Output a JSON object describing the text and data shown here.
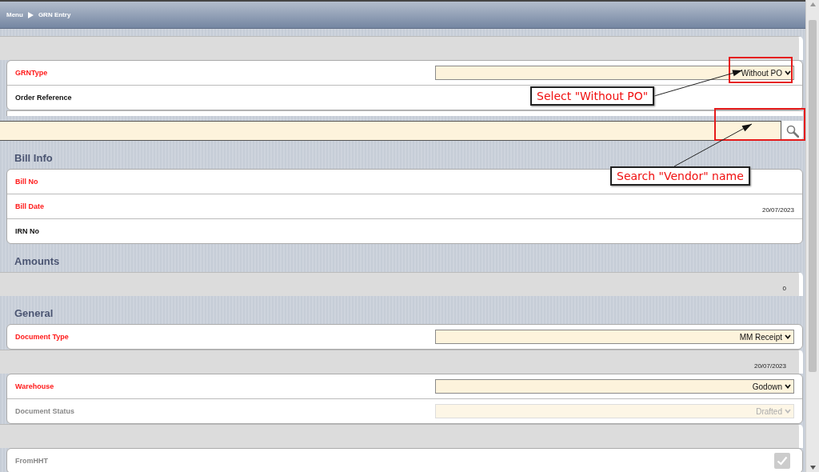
{
  "breadcrumb": [
    "Menu",
    "GRN Entry"
  ],
  "form": [
    {
      "kind": "strip"
    },
    {
      "kind": "card",
      "fields": [
        {
          "label": "GRNType",
          "kind": "select",
          "required": true,
          "disabled": false,
          "value": "Without PO"
        },
        {
          "label": "Order Reference",
          "kind": "plain",
          "required": false,
          "disabled": false
        }
      ]
    },
    {
      "kind": "search"
    },
    {
      "kind": "heading",
      "text": "Bill Info"
    },
    {
      "kind": "card",
      "fields": [
        {
          "label": "Bill No",
          "kind": "plain",
          "required": true,
          "disabled": false
        },
        {
          "label": "Bill Date",
          "kind": "plain",
          "required": true,
          "disabled": false,
          "value": "20/07/2023"
        },
        {
          "label": "IRN No",
          "kind": "plain",
          "required": false,
          "disabled": false
        }
      ]
    },
    {
      "kind": "heading",
      "text": "Amounts"
    },
    {
      "kind": "strip",
      "value": "0"
    },
    {
      "kind": "heading",
      "text": "General"
    },
    {
      "kind": "card",
      "fields": [
        {
          "label": "Document Type",
          "kind": "select",
          "required": true,
          "disabled": false,
          "value": "MM Receipt"
        }
      ]
    },
    {
      "kind": "strip",
      "value": "20/07/2023"
    },
    {
      "kind": "card",
      "fields": [
        {
          "label": "Warehouse",
          "kind": "select",
          "required": true,
          "disabled": false,
          "value": "Godown"
        },
        {
          "label": "Document Status",
          "kind": "select",
          "disabled": true,
          "value": "Drafted"
        }
      ]
    },
    {
      "kind": "strip"
    },
    {
      "kind": "card",
      "fields": [
        {
          "label": "FromHHT",
          "kind": "checkbox",
          "disabled": true,
          "checked": true
        }
      ]
    }
  ],
  "annotations": [
    {
      "text": "Select \"Without PO\""
    },
    {
      "text": "Search \"Vendor\" name"
    }
  ]
}
